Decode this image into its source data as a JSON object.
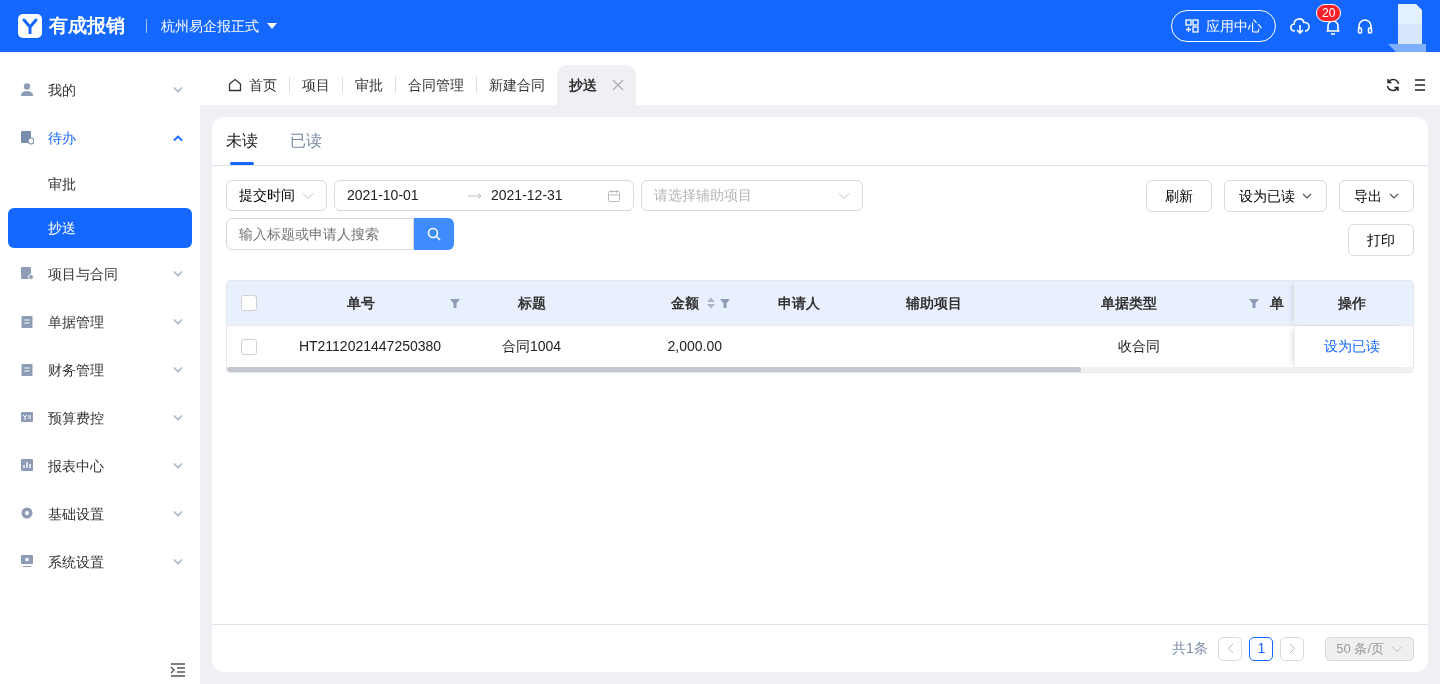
{
  "header": {
    "logo_text": "有成报销",
    "org": "杭州易企报正式",
    "app_center": "应用中心",
    "notification_count": "20"
  },
  "sidebar": {
    "items": [
      {
        "label": "我的",
        "expanded": false
      },
      {
        "label": "待办",
        "expanded": true,
        "children": [
          {
            "label": "审批",
            "selected": false
          },
          {
            "label": "抄送",
            "selected": true
          }
        ]
      },
      {
        "label": "项目与合同",
        "expanded": false
      },
      {
        "label": "单据管理",
        "expanded": false
      },
      {
        "label": "财务管理",
        "expanded": false
      },
      {
        "label": "预算费控",
        "expanded": false
      },
      {
        "label": "报表中心",
        "expanded": false
      },
      {
        "label": "基础设置",
        "expanded": false
      },
      {
        "label": "系统设置",
        "expanded": false
      }
    ]
  },
  "page_tabs": [
    {
      "label": "首页",
      "selected": false,
      "kind": "home"
    },
    {
      "label": "项目",
      "selected": false,
      "kind": "plain"
    },
    {
      "label": "审批",
      "selected": false,
      "kind": "plain"
    },
    {
      "label": "合同管理",
      "selected": false,
      "kind": "plain"
    },
    {
      "label": "新建合同",
      "selected": false,
      "kind": "plain"
    },
    {
      "label": "抄送",
      "selected": true,
      "kind": "closable"
    }
  ],
  "read_tabs": [
    {
      "label": "未读",
      "selected": true
    },
    {
      "label": "已读",
      "selected": false
    }
  ],
  "filters": {
    "time_type": "提交时间",
    "date_start": "2021-10-01",
    "date_end": "2021-12-31",
    "aux_placeholder": "请选择辅助项目",
    "search_placeholder": "输入标题或申请人搜索"
  },
  "actions": [
    {
      "label": "刷新",
      "dropdown": false
    },
    {
      "label": "设为已读",
      "dropdown": true
    },
    {
      "label": "导出",
      "dropdown": true
    }
  ],
  "print_button": "打印",
  "table": {
    "columns": [
      {
        "label": "单号",
        "filter": true,
        "sort": false
      },
      {
        "label": "标题",
        "filter": false,
        "sort": false
      },
      {
        "label": "金额",
        "filter": true,
        "sort": true
      },
      {
        "label": "申请人",
        "filter": false,
        "sort": false
      },
      {
        "label": "辅助项目",
        "filter": false,
        "sort": false
      },
      {
        "label": "单据类型",
        "filter": true,
        "sort": false
      },
      {
        "label": "单",
        "filter": false,
        "sort": false
      }
    ],
    "all_checked": false,
    "action_column": "操作",
    "rows": [
      {
        "checked": false,
        "cells": [
          "HT2112021447250380",
          "合同1004",
          "2,000.00",
          null,
          null,
          "收合同",
          null
        ],
        "action": "设为已读"
      }
    ]
  },
  "pagination": {
    "total": "共1条",
    "pages": [
      {
        "label": "1",
        "selected": true
      }
    ],
    "page_size": "50 条/页"
  }
}
